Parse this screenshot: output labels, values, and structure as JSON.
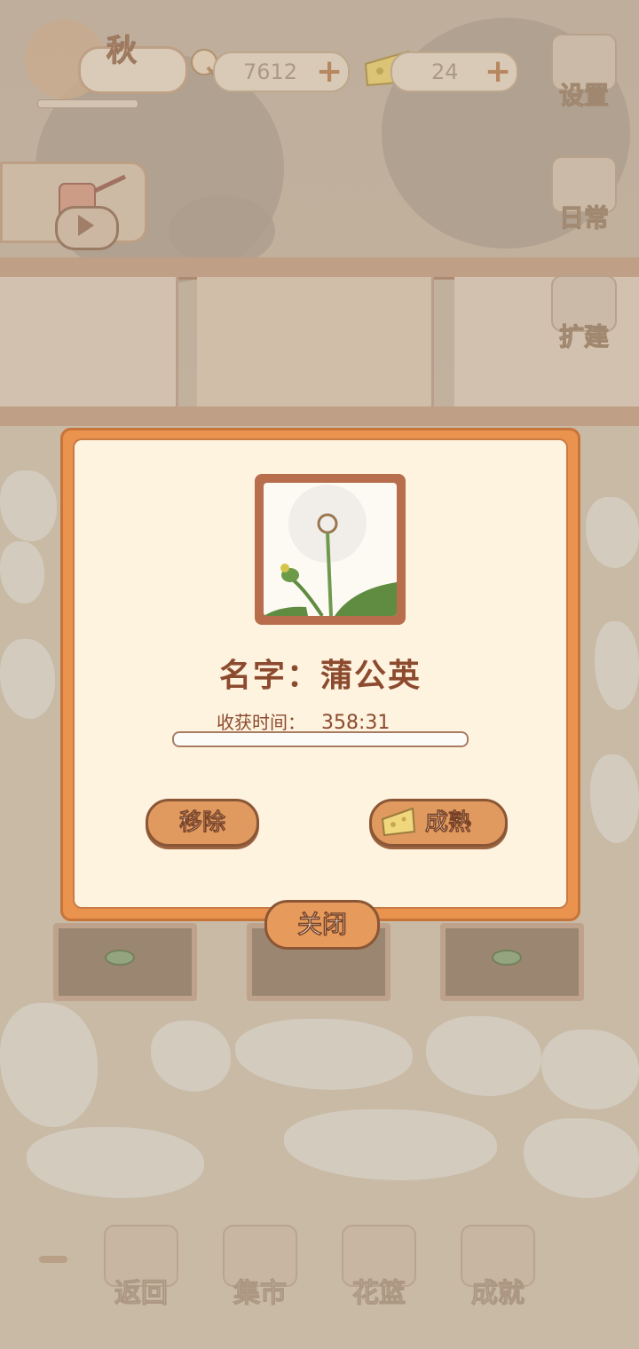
{
  "hud": {
    "season": "秋",
    "fish_count": "7612",
    "cheese_count": "24",
    "plus_symbol": "+"
  },
  "side_menu": [
    {
      "label": "设置",
      "icon": "gear-icon"
    },
    {
      "label": "日常",
      "icon": "notebook-icon"
    },
    {
      "label": "扩建",
      "icon": "hammer-icon"
    }
  ],
  "dialog": {
    "name_text": "名字：蒲公英",
    "time_label": "收获时间：",
    "time_value": "358:31",
    "progress": 0.0,
    "remove_label": "移除",
    "ripen_label": "成熟",
    "close_label": "关闭"
  },
  "bottom_nav": [
    {
      "label": "返回",
      "icon": "window-icon"
    },
    {
      "label": "集市",
      "icon": "market-stall-icon"
    },
    {
      "label": "花篮",
      "icon": "flower-basket-icon"
    },
    {
      "label": "成就",
      "icon": "trophy-icon"
    }
  ],
  "colors": {
    "dialog_border": "#e9934f",
    "dialog_bg": "#fef3df",
    "text_brown": "#8c4a2e",
    "button_fill": "#e0995e"
  }
}
